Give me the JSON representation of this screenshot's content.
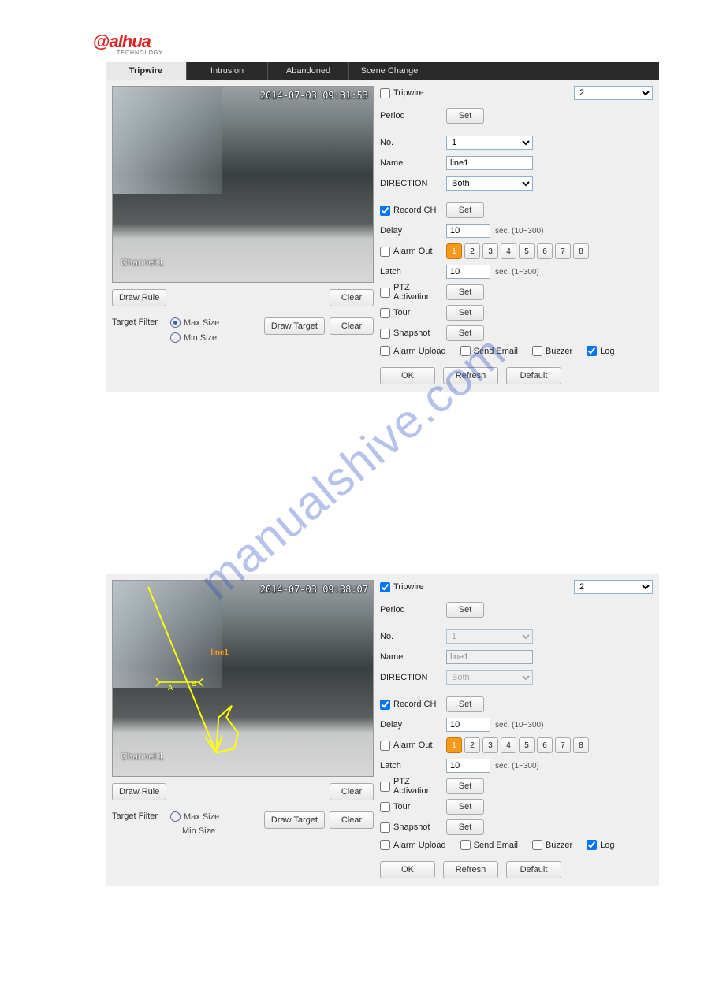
{
  "logo": {
    "brand": "alhua",
    "sub": "TECHNOLOGY"
  },
  "watermark": "manualshive.com",
  "tabs": [
    "Tripwire",
    "Intrusion",
    "Abandoned",
    "Scene Change"
  ],
  "active_tab": "Tripwire",
  "panel1": {
    "video": {
      "timestamp": "2014-07-03 09:31:53",
      "channel": "Channel:1"
    },
    "draw_rule": "Draw Rule",
    "clear": "Clear",
    "target_filter": "Target Filter",
    "max_size": "Max Size",
    "min_size": "Min Size",
    "draw_target": "Draw Target",
    "main": {
      "tripwire_label": "Tripwire",
      "tripwire_checked": false,
      "select_val": "2",
      "period": "Period",
      "set": "Set",
      "no": "No.",
      "no_val": "1",
      "name": "Name",
      "name_val": "line1",
      "direction": "DIRECTION",
      "direction_val": "Both",
      "record_ch": "Record CH",
      "record_checked": true,
      "delay": "Delay",
      "delay_val": "10",
      "delay_hint": "sec. (10~300)",
      "alarm_out": "Alarm Out",
      "alarm_checked": false,
      "alarm_buttons": [
        "1",
        "2",
        "3",
        "4",
        "5",
        "6",
        "7",
        "8"
      ],
      "alarm_active": "1",
      "latch": "Latch",
      "latch_val": "10",
      "latch_hint": "sec. (1~300)",
      "ptz": "PTZ Activation",
      "ptz_checked": false,
      "tour": "Tour",
      "tour_checked": false,
      "snapshot": "Snapshot",
      "snapshot_checked": false,
      "alarm_upload": "Alarm Upload",
      "send_email": "Send Email",
      "buzzer": "Buzzer",
      "log": "Log",
      "log_checked": true,
      "ok": "OK",
      "refresh": "Refresh",
      "default": "Default"
    }
  },
  "panel2": {
    "video": {
      "timestamp": "2014-07-03 09:38:07",
      "channel": "Channel:1",
      "overlay_label": "line1"
    },
    "draw_rule": "Draw Rule",
    "clear": "Clear",
    "target_filter": "Target Filter",
    "max_size": "Max Size",
    "min_size": "Min Size",
    "draw_target": "Draw Target",
    "main": {
      "tripwire_label": "Tripwire",
      "tripwire_checked": true,
      "select_val": "2",
      "period": "Period",
      "set": "Set",
      "no": "No.",
      "no_val": "1",
      "name": "Name",
      "name_val": "line1",
      "direction": "DIRECTION",
      "direction_val": "Both",
      "record_ch": "Record CH",
      "record_checked": true,
      "delay": "Delay",
      "delay_val": "10",
      "delay_hint": "sec. (10~300)",
      "alarm_out": "Alarm Out",
      "alarm_checked": false,
      "alarm_buttons": [
        "1",
        "2",
        "3",
        "4",
        "5",
        "6",
        "7",
        "8"
      ],
      "alarm_active": "1",
      "latch": "Latch",
      "latch_val": "10",
      "latch_hint": "sec. (1~300)",
      "ptz": "PTZ Activation",
      "ptz_checked": false,
      "tour": "Tour",
      "tour_checked": false,
      "snapshot": "Snapshot",
      "snapshot_checked": false,
      "alarm_upload": "Alarm Upload",
      "send_email": "Send Email",
      "buzzer": "Buzzer",
      "log": "Log",
      "log_checked": true,
      "ok": "OK",
      "refresh": "Refresh",
      "default": "Default"
    }
  }
}
